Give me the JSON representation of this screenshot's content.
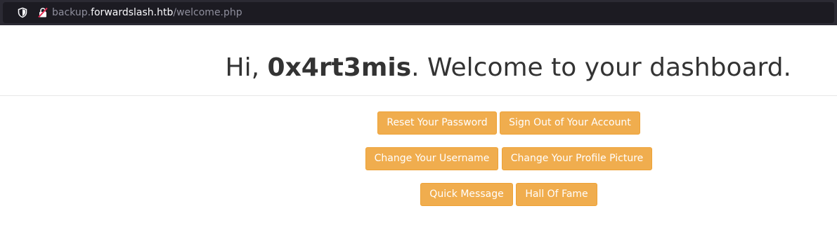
{
  "browser": {
    "url_host_prefix": "backup.",
    "url_host_main": "forwardslash.htb",
    "url_path": "/welcome.php",
    "icons": [
      "shield-icon",
      "insecure-lock-icon"
    ]
  },
  "header": {
    "greeting_prefix": "Hi, ",
    "username": "0x4rt3mis",
    "greeting_suffix": ". Welcome to your dashboard."
  },
  "actions": {
    "reset_password": "Reset Your Password",
    "sign_out": "Sign Out of Your Account",
    "change_username": "Change Your Username",
    "change_profile_picture": "Change Your Profile Picture",
    "quick_message": "Quick Message",
    "hall_of_fame": "Hall Of Fame"
  },
  "colors": {
    "button_bg": "#f0ad4e",
    "button_border": "#eea236",
    "browser_bar": "#2b2a33",
    "text": "#333333"
  }
}
